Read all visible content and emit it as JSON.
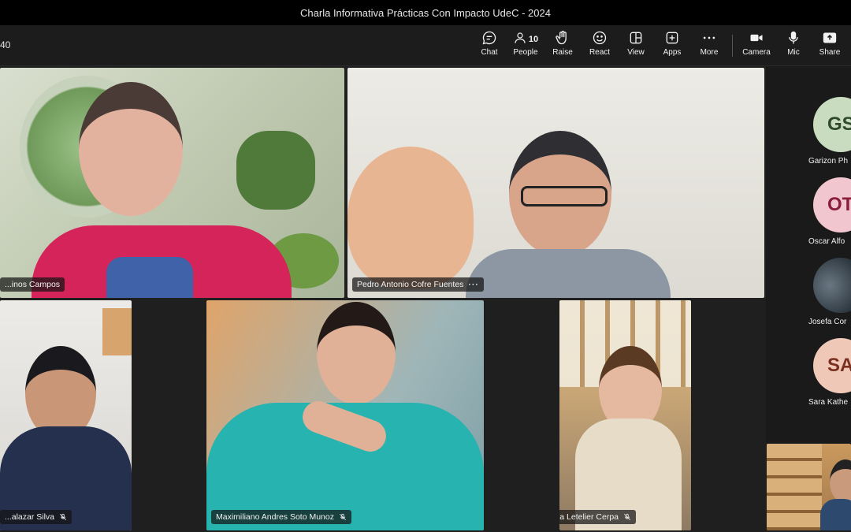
{
  "window": {
    "title": "Charla Informativa Prácticas Con Impacto UdeC - 2024"
  },
  "toolbar": {
    "timer": "40",
    "people_count": "10",
    "buttons": [
      {
        "label": "Chat",
        "icon": "chat-icon"
      },
      {
        "label": "People",
        "icon": "people-icon"
      },
      {
        "label": "Raise",
        "icon": "hand-icon"
      },
      {
        "label": "React",
        "icon": "smiley-icon"
      },
      {
        "label": "View",
        "icon": "view-grid-icon"
      },
      {
        "label": "Apps",
        "icon": "apps-plus-icon"
      },
      {
        "label": "More",
        "icon": "more-dots-icon"
      },
      {
        "label": "Camera",
        "icon": "camera-icon"
      },
      {
        "label": "Mic",
        "icon": "mic-icon"
      },
      {
        "label": "Share",
        "icon": "share-icon"
      }
    ]
  },
  "participants": [
    {
      "name": "...inos Campos",
      "muted": false
    },
    {
      "name": "Pedro Antonio Cofre Fuentes",
      "muted": false,
      "has_more_menu": true
    },
    {
      "name": "...alazar Silva",
      "muted": true
    },
    {
      "name": "Maximiliano Andres Soto Munoz",
      "muted": true
    },
    {
      "name": "Aracely Constanza Letelier Cerpa",
      "muted": true
    }
  ],
  "sidebar": {
    "items": [
      {
        "initials": "GS",
        "label": "Garizon Ph",
        "bg": "#c9dcc0",
        "fg": "#2e4a2a"
      },
      {
        "initials": "OT",
        "label": "Oscar Alfo",
        "bg": "#f2c6cf",
        "fg": "#8a1f3a"
      },
      {
        "initials": "",
        "label": "Josefa Cor",
        "bg": "#3b4a55",
        "fg": "#ffffff"
      },
      {
        "initials": "SA",
        "label": "Sara Kathe",
        "bg": "#f0c8b8",
        "fg": "#7a2f1f"
      }
    ]
  },
  "colors": {
    "titlebar": "#000000",
    "toolbar": "#1c1c1c",
    "stage": "#1f1f1f"
  }
}
